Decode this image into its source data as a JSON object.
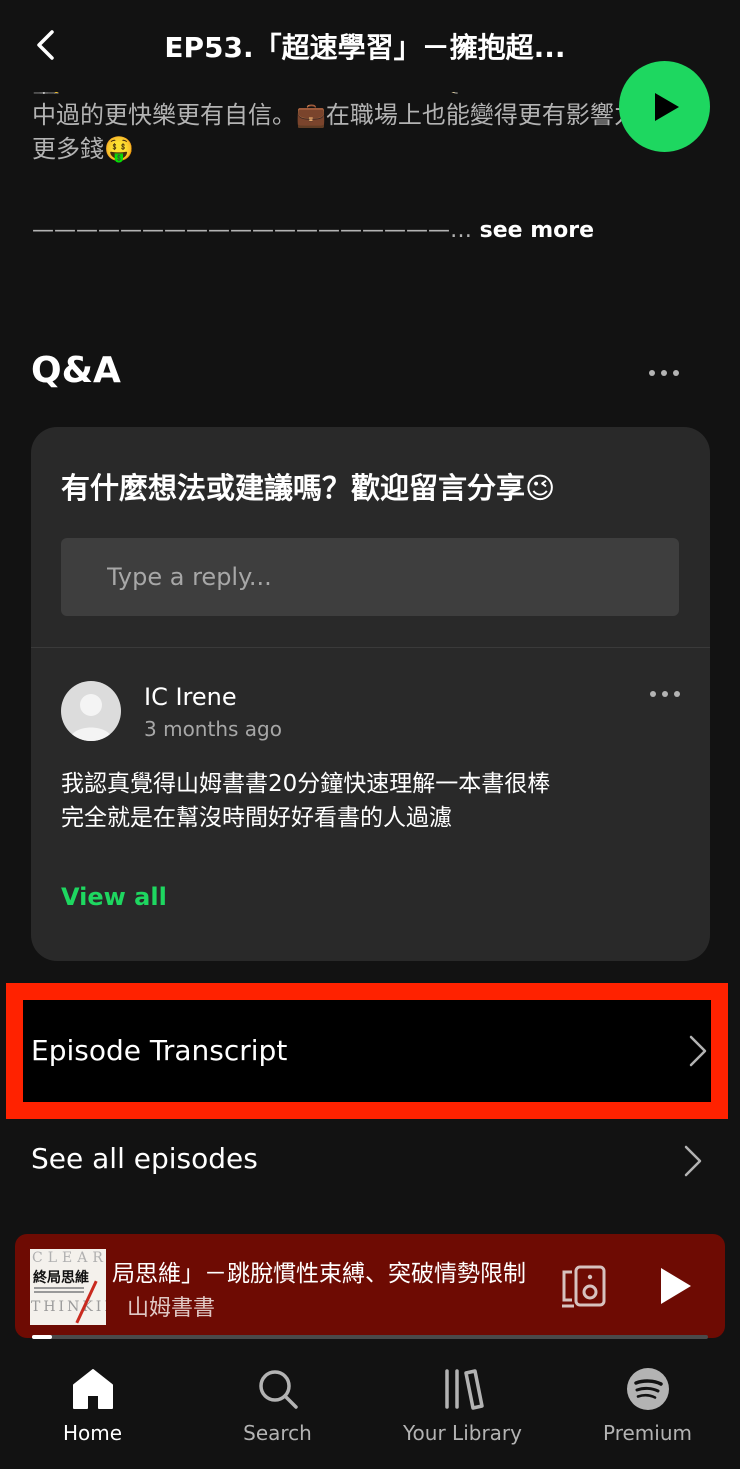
{
  "header": {
    "title": "EP53.「超速學習」－擁抱超..."
  },
  "description": {
    "line_partial": "🕵️ 如果另一個所的的學習方法的話，✏️就可以讓自己在自",
    "line1": "中過的更快樂更有自信。💼在職場上也能變得更有影響力，賺",
    "line2": "更多錢🤑",
    "divider": "———————————————————…",
    "see_more": " see more"
  },
  "qa": {
    "title": "Q&A",
    "question": "有什麼想法或建議嗎？歡迎留言分享😉",
    "reply_placeholder": "Type a reply...",
    "comment": {
      "author": "IC Irene",
      "time": "3 months ago",
      "text_line1": "我認真覺得山姆書書20分鐘快速理解一本書很棒",
      "text_line2": "完全就是在幫沒時間好好看書的人過濾"
    },
    "view_all": "View all"
  },
  "rows": {
    "transcript": "Episode Transcript",
    "all_episodes": "See all episodes"
  },
  "mini_player": {
    "cover_clear": "CLEAR",
    "cover_title": "終局思維",
    "cover_thinking": "THINKING",
    "track_title": "局思維」－跳脫慣性束縛、突破情勢限制",
    "artist": "山姆書書",
    "progress": 0.03
  },
  "nav": {
    "items": [
      {
        "label": "Home",
        "icon": "home-icon"
      },
      {
        "label": "Search",
        "icon": "search-icon"
      },
      {
        "label": "Your Library",
        "icon": "library-icon"
      },
      {
        "label": "Premium",
        "icon": "spotify-icon"
      }
    ]
  },
  "colors": {
    "background": "#121212",
    "accent_green": "#1ed760",
    "card": "#292929",
    "highlight_box": "#ff2200",
    "mini_player": "#6e0b03"
  }
}
